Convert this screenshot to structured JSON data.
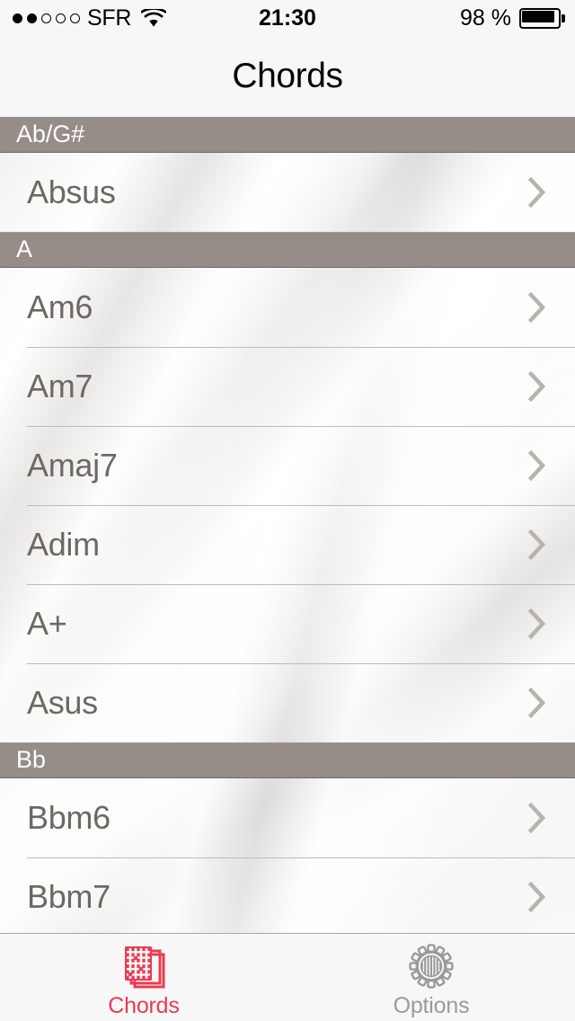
{
  "status_bar": {
    "signal_dots_total": 5,
    "signal_dots_filled": 2,
    "carrier": "SFR",
    "wifi_icon": "wifi-icon",
    "time": "21:30",
    "battery_percent": "98 %",
    "battery_level": 98
  },
  "nav": {
    "title": "Chords"
  },
  "colors": {
    "section_header_bg": "#968d88",
    "section_header_text": "#ffffff",
    "cell_text": "#6e6862",
    "accent_red": "#ea3b52",
    "tab_inactive": "#9a9a9a",
    "nav_bg": "#f7f7f7",
    "separator": "#bdbbb8"
  },
  "list": {
    "sections": [
      {
        "header": "Ab/G#",
        "rows": [
          {
            "label": "Absus",
            "accessory": "chevron-right-icon"
          }
        ]
      },
      {
        "header": "A",
        "rows": [
          {
            "label": "Am6",
            "accessory": "chevron-right-icon"
          },
          {
            "label": "Am7",
            "accessory": "chevron-right-icon"
          },
          {
            "label": "Amaj7",
            "accessory": "chevron-right-icon"
          },
          {
            "label": "Adim",
            "accessory": "chevron-right-icon"
          },
          {
            "label": "A+",
            "accessory": "chevron-right-icon"
          },
          {
            "label": "Asus",
            "accessory": "chevron-right-icon"
          }
        ]
      },
      {
        "header": "Bb",
        "rows": [
          {
            "label": "Bbm6",
            "accessory": "chevron-right-icon"
          },
          {
            "label": "Bbm7",
            "accessory": "chevron-right-icon"
          }
        ]
      }
    ]
  },
  "tabbar": {
    "tabs": [
      {
        "label": "Chords",
        "icon": "chord-charts-icon",
        "active": true
      },
      {
        "label": "Options",
        "icon": "gear-icon",
        "active": false
      }
    ]
  }
}
